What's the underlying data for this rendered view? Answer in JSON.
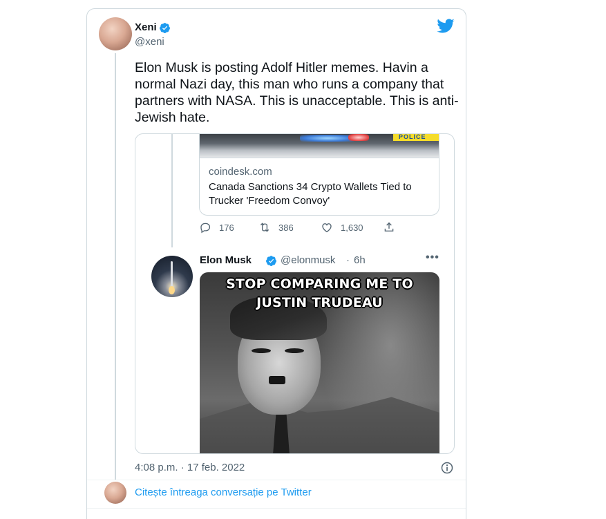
{
  "tweet": {
    "author_name": "Xeni",
    "author_handle": "@xeni",
    "text": "Elon Musk is posting Adolf Hitler memes. Havin a normal Nazi day, this man who runs a company that partners with NASA. This is unacceptable. This is anti-Jewish hate.",
    "timestamp": "4:08 p.m. · 17 feb. 2022",
    "read_more": "Citește întreaga conversație pe Twitter"
  },
  "quote": {
    "link_card": {
      "image_sign": "POLICE",
      "domain": "coindesk.com",
      "title": "Canada Sanctions 34 Crypto Wallets Tied to Trucker 'Freedom Convoy'"
    },
    "actions": {
      "replies": "176",
      "retweets": "386",
      "likes": "1,630"
    },
    "author_name": "Elon Musk",
    "author_handle": "@elonmusk",
    "separator": "·",
    "time": "6h",
    "more": "•••",
    "meme_caption": "STOP COMPARING ME TO JUSTIN TRUDEAU"
  },
  "colors": {
    "twitter_blue": "#1d9bf0",
    "text_primary": "#0f1419",
    "text_secondary": "#536471",
    "border": "#cfd9de"
  },
  "icons": [
    "verified-badge-icon",
    "twitter-bird-icon",
    "reply-icon",
    "retweet-icon",
    "like-icon",
    "share-icon",
    "more-icon",
    "info-icon"
  ]
}
